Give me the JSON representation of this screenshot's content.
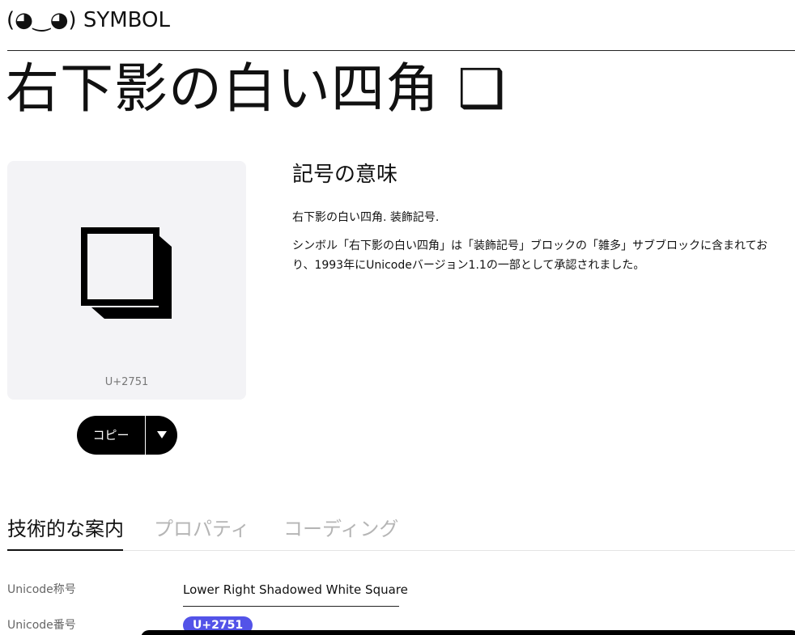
{
  "site": {
    "logo": "(◕‿◕) SYMBOL"
  },
  "symbol": {
    "title": "右下影の白い四角 ❑",
    "glyph": "❑",
    "code": "U+2751"
  },
  "actions": {
    "copy_label": "コピー",
    "dropdown_icon": "chevron-down-icon"
  },
  "meaning": {
    "heading": "記号の意味",
    "short": "右下影の白い四角. 装飾記号.",
    "description": "シンボル「右下影の白い四角」は「装飾記号」ブロックの「雑多」サブブロックに含まれており、1993年にUnicodeバージョン1.1の一部として承認されました。"
  },
  "tabs": [
    {
      "label": "技術的な案内",
      "active": true
    },
    {
      "label": "プロパティ",
      "active": false
    },
    {
      "label": "コーディング",
      "active": false
    }
  ],
  "technical": {
    "rows": [
      {
        "label": "Unicode称号",
        "value": "Lower Right Shadowed White Square"
      },
      {
        "label": "Unicode番号",
        "value": "U+2751"
      }
    ]
  },
  "colors": {
    "badge": "#5353e8",
    "card_bg": "#f3f3f6",
    "button_bg": "#000000"
  }
}
